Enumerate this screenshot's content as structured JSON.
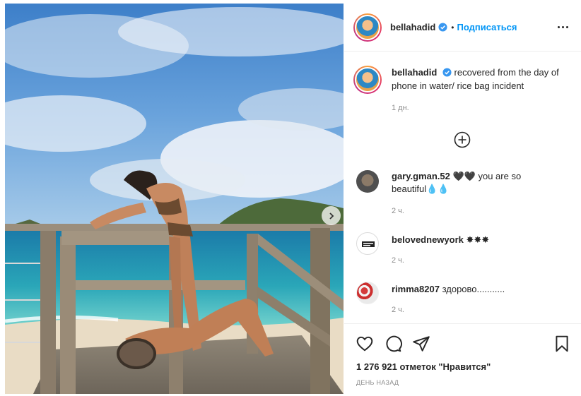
{
  "post": {
    "username": "bellahadid",
    "dot": "•",
    "follow_label": "Подписаться",
    "caption": "recovered from the day of phone in water/ rice bag incident",
    "caption_time": "1 дн.",
    "likes": "1 276 921 отметок \"Нравится\"",
    "posted_ago": "ДЕНЬ НАЗАД"
  },
  "comments": [
    {
      "username": "gary.gman.52",
      "text": "🖤🖤 you are so beautiful💧💧",
      "time": "2 ч."
    },
    {
      "username": "belovednewyork",
      "text": "✸✸✸",
      "time": "2 ч."
    },
    {
      "username": "rimma8207",
      "text": "здорово...........",
      "time": "2 ч."
    }
  ],
  "colors": {
    "link_blue": "#0095f6",
    "text": "#262626",
    "muted": "#8e8e8e",
    "verified_blue": "#3897f0"
  },
  "icons": [
    "verified-badge-icon",
    "more-options-icon",
    "add-comment-icon",
    "heart-icon",
    "comment-icon",
    "share-icon",
    "bookmark-icon",
    "next-photo-icon"
  ]
}
